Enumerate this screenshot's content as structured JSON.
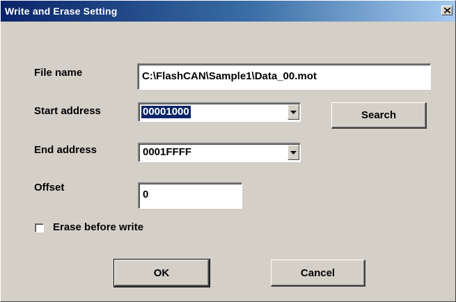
{
  "window": {
    "title": "Write and Erase Setting",
    "close_label": "×"
  },
  "form": {
    "file_name": {
      "label": "File name",
      "value": "C:\\FlashCAN\\Sample1\\Data_00.mot"
    },
    "start_address": {
      "label": "Start address",
      "value": "00001000"
    },
    "end_address": {
      "label": "End address",
      "value": "0001FFFF"
    },
    "offset": {
      "label": "Offset",
      "value": "0"
    },
    "erase_before_write": {
      "label": "Erase before write",
      "checked": false
    }
  },
  "buttons": {
    "search": "Search",
    "ok": "OK",
    "cancel": "Cancel"
  },
  "colors": {
    "title_start": "#0a246a",
    "title_end": "#a6caf0",
    "face": "#d4d0c8",
    "selection": "#0a246a"
  },
  "icons": {
    "close": "close-icon",
    "dropdown": "chevron-down-icon"
  }
}
